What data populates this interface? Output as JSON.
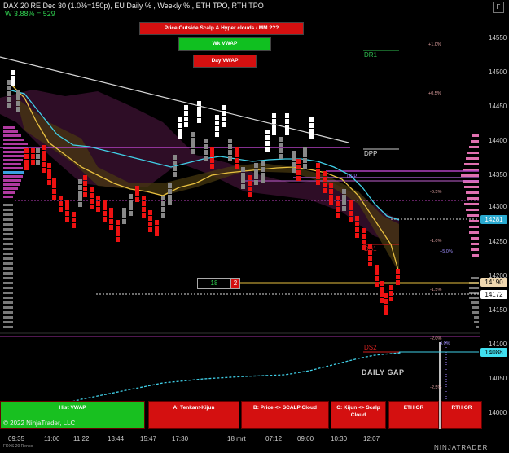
{
  "header": {
    "title": "DAX 20 RE Dec 30 (1.0%=150p), EU Daily % , Weekly % , ETH TPO, RTH TPO",
    "subtitle": "W 3.88% = 529",
    "close_icon_label": "F"
  },
  "banners": {
    "alert": "Price Outside Scalp & Hyper clouds / MM ???",
    "wk_vwap": "Wk VWAP",
    "day_vwap": "Day VWAP"
  },
  "colors": {
    "background": "#000000",
    "bull_bar": "#ffffff",
    "bear_bar": "#ee1111",
    "neutral_bar": "#888888",
    "cyan_line": "#40d0e8",
    "gold_line": "#e8c040",
    "magenta_line": "#d040d0",
    "banner_red": "#d41010",
    "banner_green": "#10c020"
  },
  "price_axis": {
    "ticks": [
      "14550",
      "14500",
      "14450",
      "14400",
      "14350",
      "14300",
      "14250",
      "14200",
      "14150",
      "14100",
      "14050",
      "14000"
    ],
    "tags": [
      {
        "value": "14281",
        "bg": "#2aaad0",
        "fg": "#ffffff"
      },
      {
        "value": "14190",
        "bg": "#f0d8b0",
        "fg": "#000000"
      },
      {
        "value": "14172",
        "bg": "#ffffff",
        "fg": "#000000"
      },
      {
        "value": "14088",
        "bg": "#40e0f0",
        "fg": "#000000"
      }
    ]
  },
  "percent_labels": {
    "p1": "+1.0%",
    "p2": "+0.5%",
    "p3": "-0.5%",
    "p4": "-1.0%",
    "p5": "+5.0%",
    "p6": "-1.5%",
    "p7": "-2.0%",
    "p8": "4.0%",
    "p9": "-2.5%"
  },
  "levels": {
    "dr1": "DR1",
    "dpp": "DPP",
    "ds1": "DS1",
    "ds2": "DS2",
    "dpp_small": "DPP"
  },
  "indicator": {
    "value": "18",
    "badge": "2"
  },
  "lower_panel": {
    "label": "DAILY GAP"
  },
  "bottom_buttons": [
    "Hist VWAP",
    "A: Tenkan>Kijun",
    "B: Price <> SCALP Cloud",
    "C: Kijun <> Scalp Cloud",
    "ETH OR",
    "RTH OR"
  ],
  "time_axis": [
    "09:35",
    "11:00",
    "11:22",
    "13:44",
    "15:47",
    "17:30",
    "18 mrt",
    "07:12",
    "09:00",
    "10:30",
    "12:07"
  ],
  "footer": {
    "copyright": "© 2022 NinjaTrader, LLC",
    "chart_name": "FDXS 20 Renko",
    "brand": "NINJATRADER"
  }
}
